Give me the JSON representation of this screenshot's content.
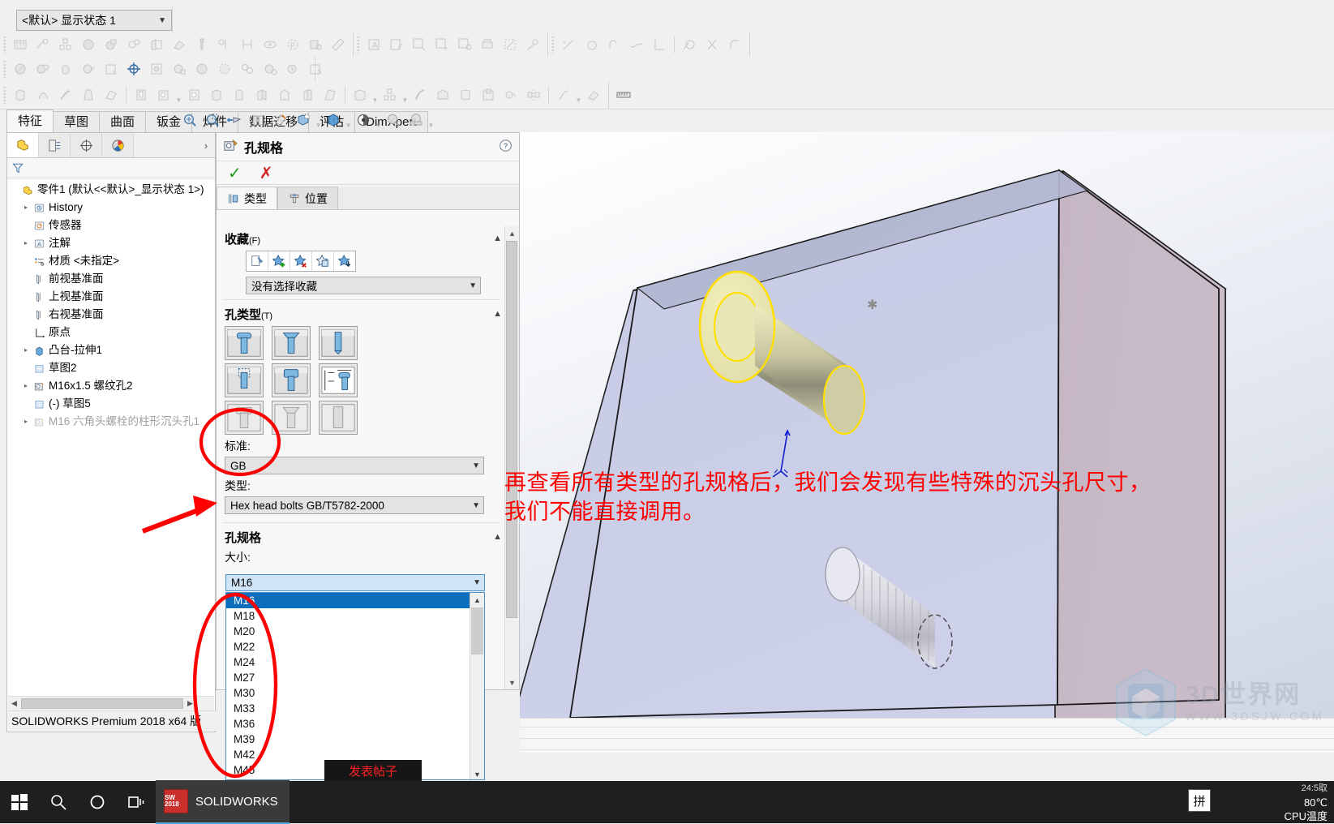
{
  "window": {
    "display_state": "<默认> 显示状态 1",
    "status_bar": "SOLIDWORKS Premium 2018 x64 版"
  },
  "command_tabs": [
    {
      "label": "特征",
      "active": true
    },
    {
      "label": "草图",
      "active": false
    },
    {
      "label": "曲面",
      "active": false
    },
    {
      "label": "钣金",
      "active": false
    },
    {
      "label": "焊件",
      "active": false
    },
    {
      "label": "数据迁移",
      "active": false
    },
    {
      "label": "评估",
      "active": false
    },
    {
      "label": "DimXpert",
      "active": false
    }
  ],
  "feature_manager": {
    "tabs": [
      "feature-tree-icon",
      "property-manager-icon",
      "configuration-icon",
      "appearance-icon"
    ],
    "expand_label": "›",
    "filter_icon": "filter-icon",
    "tree": [
      {
        "label": "零件1  (默认<<默认>_显示状态 1>)",
        "icon": "part-icon",
        "arrow": "",
        "indent": 0,
        "dim": false
      },
      {
        "label": "History",
        "icon": "history-icon",
        "arrow": "▸",
        "indent": 1,
        "dim": false
      },
      {
        "label": "传感器",
        "icon": "sensor-icon",
        "arrow": "",
        "indent": 1,
        "dim": false
      },
      {
        "label": "注解",
        "icon": "annotation-icon",
        "arrow": "▸",
        "indent": 1,
        "dim": false
      },
      {
        "label": "材质 <未指定>",
        "icon": "material-icon",
        "arrow": "",
        "indent": 1,
        "dim": false
      },
      {
        "label": "前视基准面",
        "icon": "plane-icon",
        "arrow": "",
        "indent": 1,
        "dim": false
      },
      {
        "label": "上视基准面",
        "icon": "plane-icon",
        "arrow": "",
        "indent": 1,
        "dim": false
      },
      {
        "label": "右视基准面",
        "icon": "plane-icon",
        "arrow": "",
        "indent": 1,
        "dim": false
      },
      {
        "label": "原点",
        "icon": "origin-icon",
        "arrow": "",
        "indent": 1,
        "dim": false
      },
      {
        "label": "凸台-拉伸1",
        "icon": "boss-extrude-icon",
        "arrow": "▸",
        "indent": 1,
        "dim": false
      },
      {
        "label": "草图2",
        "icon": "sketch-icon",
        "arrow": "",
        "indent": 1,
        "dim": false
      },
      {
        "label": "M16x1.5 螺纹孔2",
        "icon": "hole-wizard-icon",
        "arrow": "▸",
        "indent": 1,
        "dim": false
      },
      {
        "label": "(-) 草图5",
        "icon": "sketch-icon",
        "arrow": "",
        "indent": 1,
        "dim": false
      },
      {
        "label": "M16 六角头螺栓的柱形沉头孔1",
        "icon": "hole-wizard-icon",
        "arrow": "▸",
        "indent": 1,
        "dim": true
      }
    ]
  },
  "property_manager": {
    "title": "孔规格",
    "title_icon": "hole-wizard-icon",
    "help_icon": "help-icon",
    "ok_icon": "check-icon",
    "cancel_icon": "x-icon",
    "tabs": [
      {
        "label": "类型",
        "icon": "hole-type-icon",
        "active": true
      },
      {
        "label": "位置",
        "icon": "hole-position-icon",
        "active": false
      }
    ],
    "favorite": {
      "section_title": "收藏",
      "section_suffix": "(F)",
      "buttons": [
        "apply-defaults-icon",
        "add-favorite-icon",
        "delete-favorite-icon",
        "save-favorite-icon",
        "load-favorite-icon"
      ],
      "value": "没有选择收藏"
    },
    "hole_type": {
      "section_title": "孔类型",
      "section_suffix": "(T)",
      "icons": [
        "counterbore-icon",
        "countersink-icon",
        "hole-icon",
        "straight-tap-icon",
        "tapered-tap-icon",
        "legacy-hole-icon",
        "counterbore-slot-icon",
        "countersink-slot-icon",
        "slot-icon"
      ],
      "standard_label": "标准:",
      "standard_value": "GB",
      "type_label": "类型:",
      "type_value": "Hex head bolts GB/T5782-2000"
    },
    "hole_spec": {
      "section_title": "孔规格",
      "size_label": "大小:",
      "size_value": "M16",
      "size_options": [
        "M16",
        "M18",
        "M20",
        "M22",
        "M24",
        "M27",
        "M30",
        "M33",
        "M36",
        "M39",
        "M42",
        "M45"
      ],
      "selected_index": 0
    }
  },
  "viewport": {
    "toolbar_icons": [
      "zoom-to-fit-icon",
      "zoom-to-area-icon",
      "previous-view-icon",
      "section-view-icon",
      "view-orientation-icon",
      "display-style-icon",
      "hide-show-icon",
      "edit-appearance-icon",
      "apply-scene-icon",
      "view-settings-icon"
    ],
    "annotation_line1": "再查看所有类型的孔规格后，我们会发现有些特殊的沉头孔尺寸，",
    "annotation_line2": "我们不能直接调用。",
    "annotation_color": "#ff0000",
    "origin_marker": "origin-triad-icon"
  },
  "watermark": {
    "line1": "3D世界网",
    "line2": "WWW.3DSJW.COM",
    "logo": "cube-logo-icon"
  },
  "taskbar": {
    "start_icon": "windows-start-icon",
    "search_icon": "search-icon",
    "cortana_icon": "cortana-circle-icon",
    "taskview_icon": "task-view-icon",
    "app_label": "SOLIDWORKS",
    "app_badge": "SW 2018",
    "ime_label": "拼",
    "tray_line1": "24:5取",
    "tray_temp": "80℃",
    "tray_label": "CPU温度",
    "popup_text": "发表帖子"
  },
  "colors": {
    "accent": "#0a6ebd",
    "markup_red": "#ff0000",
    "ok_green": "#1a9c1a",
    "cancel_red": "#d32020",
    "face_front": "#c4c8e2",
    "face_side": "#c3b3c2",
    "face_top": "#a9afc9",
    "highlight_yellow": "#ffff00"
  }
}
